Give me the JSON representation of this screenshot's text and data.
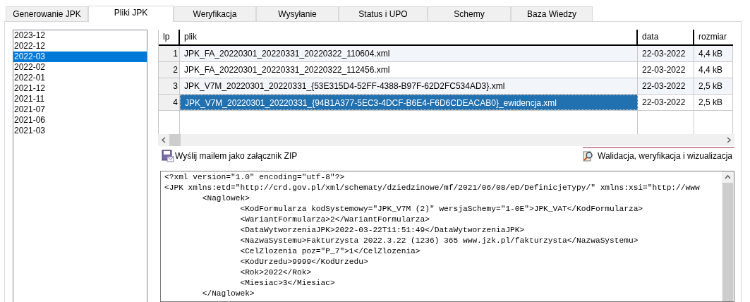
{
  "tabs": [
    {
      "label": "Generowanie JPK",
      "selected": false
    },
    {
      "label": "Pliki JPK",
      "selected": true
    },
    {
      "label": "Weryfikacja",
      "selected": false
    },
    {
      "label": "Wysyłanie",
      "selected": false
    },
    {
      "label": "Status i UPO",
      "selected": false
    },
    {
      "label": "Schemy",
      "selected": false
    },
    {
      "label": "Baza Wiedzy",
      "selected": false
    }
  ],
  "periods": [
    {
      "label": "2023-12",
      "selected": false
    },
    {
      "label": "2022-12",
      "selected": false
    },
    {
      "label": "2022-03",
      "selected": true
    },
    {
      "label": "2022-02",
      "selected": false
    },
    {
      "label": "2022-01",
      "selected": false
    },
    {
      "label": "2021-12",
      "selected": false
    },
    {
      "label": "2021-11",
      "selected": false
    },
    {
      "label": "2021-07",
      "selected": false
    },
    {
      "label": "2021-06",
      "selected": false
    },
    {
      "label": "2021-03",
      "selected": false
    }
  ],
  "table": {
    "columns": [
      "lp",
      "plik",
      "data",
      "rozmiar"
    ],
    "rows": [
      {
        "lp": "1",
        "plik": "JPK_FA_20220301_20220331_20220322_110604.xml",
        "data": "22-03-2022",
        "rozmiar": "4,4 kB",
        "selected": false
      },
      {
        "lp": "2",
        "plik": "JPK_FA_20220301_20220331_20220322_112456.xml",
        "data": "22-03-2022",
        "rozmiar": "4,4 kB",
        "selected": false
      },
      {
        "lp": "3",
        "plik": "JPK_V7M_20220301_20220331_{53E315D4-52FF-4388-B97F-62D2FC534AD3}.xml",
        "data": "22-03-2022",
        "rozmiar": "2,5 kB",
        "selected": false
      },
      {
        "lp": "4",
        "plik": "JPK_V7M_20220301_20220331_{94B1A377-5EC3-4DCF-B6E4-F6D6CDEACAB0}_ewidencja.xml",
        "data": "22-03-2022",
        "rozmiar": "2,5 kB",
        "selected": true
      }
    ]
  },
  "actions": {
    "email": "Wyślij mailem jako załącznik ZIP",
    "validate": "Walidacja, weryfikacja i wizualizacja"
  },
  "xml_lines": [
    "<?xml version=\"1.0\" encoding=\"utf-8\"?>",
    "<JPK xmlns:etd=\"http://crd.gov.pl/xml/schematy/dziedzinowe/mf/2021/06/08/eD/DefinicjeTypy/\" xmlns:xsi=\"http://www",
    "\t<Naglowek>",
    "\t\t<KodFormularza kodSystemowy=\"JPK_V7M (2)\" wersjaSchemy=\"1-0E\">JPK_VAT</KodFormularza>",
    "\t\t<WariantFormularza>2</WariantFormularza>",
    "\t\t<DataWytworzeniaJPK>2022-03-22T11:51:49</DataWytworzeniaJPK>",
    "\t\t<NazwaSystemu>Fakturzysta 2022.3.22 (1236) 365 www.jzk.pl/fakturzysta</NazwaSystemu>",
    "\t\t<CelZlozenia poz=\"P_7\">1</CelZlozenia>",
    "\t\t<KodUrzedu>9999</KodUrzedu>",
    "\t\t<Rok>2022</Rok>",
    "\t\t<Miesiac>3</Miesiac>",
    "\t</Naglowek>"
  ]
}
